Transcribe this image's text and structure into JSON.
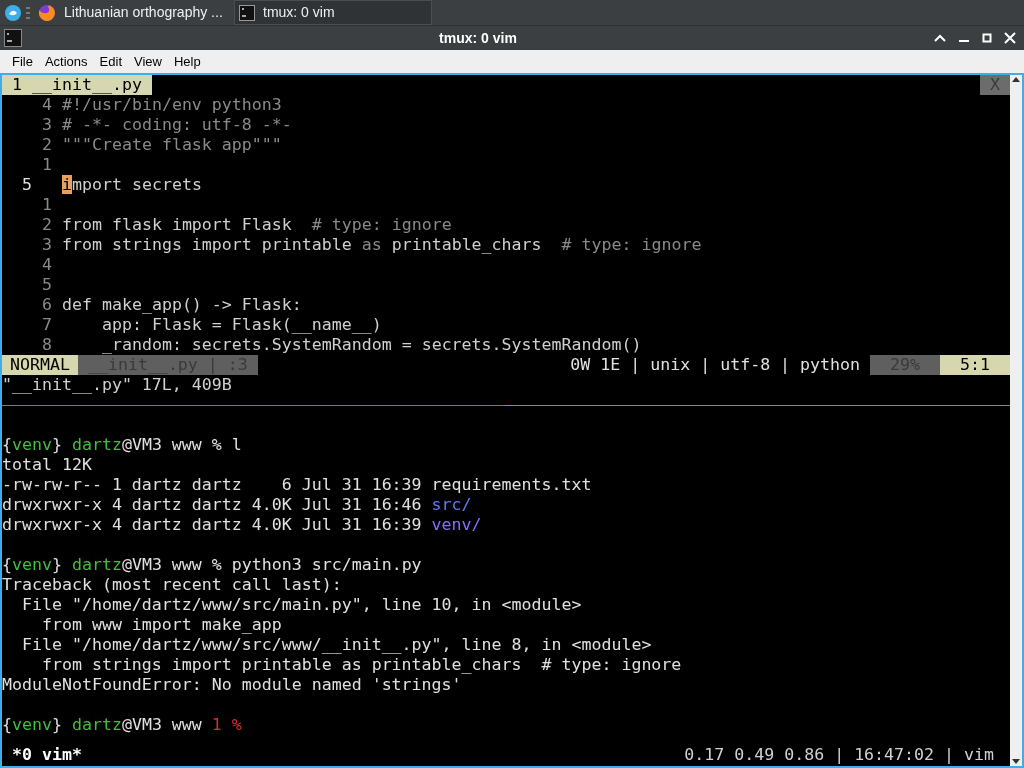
{
  "taskbar": {
    "tasks": [
      {
        "label": "Lithuanian orthography ...",
        "selected": false
      },
      {
        "label": "tmux: 0 vim",
        "selected": true
      }
    ]
  },
  "window": {
    "title": "tmux: 0 vim"
  },
  "menu": [
    "File",
    "Actions",
    "Edit",
    "View",
    "Help"
  ],
  "vim": {
    "tabs": [
      {
        "label": "1 __init__.py",
        "selected": true
      }
    ],
    "close_label": "X",
    "lines": [
      {
        "num": "4",
        "current": false,
        "segments": [
          {
            "kind": "comment",
            "text": "#!/usr/bin/env python3"
          }
        ]
      },
      {
        "num": "3",
        "current": false,
        "segments": [
          {
            "kind": "comment",
            "text": "# -*- coding: utf-8 -*-"
          }
        ]
      },
      {
        "num": "2",
        "current": false,
        "segments": [
          {
            "kind": "comment",
            "text": "\"\"\"Create flask app\"\"\""
          }
        ]
      },
      {
        "num": "1",
        "current": false
      },
      {
        "num": "5",
        "current": true,
        "segments": [
          {
            "kind": "cursor",
            "text": "i"
          },
          {
            "kind": "text",
            "text": "mport secrets"
          }
        ]
      },
      {
        "num": "1",
        "current": false
      },
      {
        "num": "2",
        "current": false,
        "segments": [
          {
            "kind": "text",
            "text": "from flask import Flask  "
          },
          {
            "kind": "comment",
            "text": "# type: ignore"
          }
        ]
      },
      {
        "num": "3",
        "current": false,
        "segments": [
          {
            "kind": "text",
            "text": "from strings import printable "
          },
          {
            "kind": "comment",
            "text": "as"
          },
          {
            "kind": "text",
            "text": " printable_chars  "
          },
          {
            "kind": "comment",
            "text": "# type: ignore"
          }
        ]
      },
      {
        "num": "4",
        "current": false
      },
      {
        "num": "5",
        "current": false
      },
      {
        "num": "6",
        "current": false,
        "segments": [
          {
            "kind": "text",
            "text": "def make_app() -> Flask:"
          }
        ]
      },
      {
        "num": "7",
        "current": false,
        "segments": [
          {
            "kind": "text",
            "text": "    app: Flask = Flask(__name__)"
          }
        ]
      },
      {
        "num": "8",
        "current": false,
        "segments": [
          {
            "kind": "text",
            "text": "    _random: secrets.SystemRandom = secrets.SystemRandom()"
          }
        ]
      }
    ],
    "status": {
      "mode": "NORMAL",
      "file": "__init__.py | :3",
      "info": "0W 1E | unix | utf-8 | python",
      "percent": "29%",
      "position": "5:1"
    },
    "message": "\"__init__.py\" 17L, 409B"
  },
  "shell": [
    {
      "lines": [
        {
          "segments": [
            {
              "kind": "plain",
              "text": "{"
            },
            {
              "kind": "green",
              "text": "venv"
            },
            {
              "kind": "plain",
              "text": "} "
            },
            {
              "kind": "green",
              "text": "dartz"
            },
            {
              "kind": "plain",
              "text": "@VM3 www % l"
            }
          ]
        },
        {
          "segments": [
            {
              "kind": "plain",
              "text": "total 12K"
            }
          ]
        },
        {
          "segments": [
            {
              "kind": "plain",
              "text": "-rw-rw-r-- 1 dartz dartz    6 Jul 31 16:39 requirements.txt"
            }
          ]
        },
        {
          "segments": [
            {
              "kind": "plain",
              "text": "drwxrwxr-x 4 dartz dartz 4.0K Jul 31 16:46 "
            },
            {
              "kind": "blue",
              "text": "src/"
            }
          ]
        },
        {
          "segments": [
            {
              "kind": "plain",
              "text": "drwxrwxr-x 4 dartz dartz 4.0K Jul 31 16:39 "
            },
            {
              "kind": "violet",
              "text": "venv/"
            }
          ]
        }
      ]
    },
    {
      "lines": [
        {
          "segments": [
            {
              "kind": "plain",
              "text": "{"
            },
            {
              "kind": "green",
              "text": "venv"
            },
            {
              "kind": "plain",
              "text": "} "
            },
            {
              "kind": "green",
              "text": "dartz"
            },
            {
              "kind": "plain",
              "text": "@VM3 www % python3 src/main.py"
            }
          ]
        },
        {
          "segments": [
            {
              "kind": "plain",
              "text": "Traceback (most recent call last):"
            }
          ]
        },
        {
          "segments": [
            {
              "kind": "plain",
              "text": "  File \"/home/dartz/www/src/main.py\", line 10, in <module>"
            }
          ]
        },
        {
          "segments": [
            {
              "kind": "plain",
              "text": "    from www import make_app"
            }
          ]
        },
        {
          "segments": [
            {
              "kind": "plain",
              "text": "  File \"/home/dartz/www/src/www/__init__.py\", line 8, in <module>"
            }
          ]
        },
        {
          "segments": [
            {
              "kind": "plain",
              "text": "    from strings import printable as printable_chars  # type: ignore"
            }
          ]
        },
        {
          "segments": [
            {
              "kind": "plain",
              "text": "ModuleNotFoundError: No module named 'strings'"
            }
          ]
        }
      ]
    },
    {
      "lines": [
        {
          "segments": [
            {
              "kind": "plain",
              "text": "{"
            },
            {
              "kind": "green",
              "text": "venv"
            },
            {
              "kind": "plain",
              "text": "} "
            },
            {
              "kind": "green",
              "text": "dartz"
            },
            {
              "kind": "plain",
              "text": "@VM3 www "
            },
            {
              "kind": "red",
              "text": "1 %"
            }
          ]
        }
      ]
    }
  ],
  "tmux_status": {
    "window": "*0 vim*",
    "right": "0.17 0.49 0.86 | 16:47:02 | vim"
  }
}
